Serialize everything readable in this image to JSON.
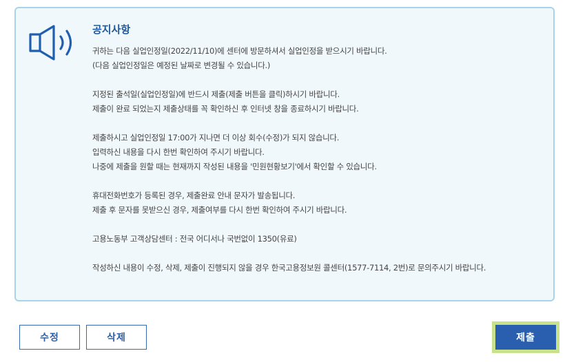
{
  "notice": {
    "icon": "speaker-icon",
    "title": "공지사항",
    "paragraphs": [
      [
        "귀하는 다음 실업인정일(2022/11/10)에 센터에 방문하셔서 실업인정을 받으시기 바랍니다.",
        "(다음 실업인정일은 예정된 날짜로 변경될 수 있습니다.)"
      ],
      [
        "지정된 출석일(실업인정일)에 반드시 제출(제출 버튼을 클릭)하시기 바랍니다.",
        "제출이 완료 되었는지 제출상태를 꼭 확인하신 후 인터넷 창을 종료하시기 바랍니다."
      ],
      [
        "제출하시고 실업인정일 17:00가 지나면 더 이상 회수(수정)가 되지 않습니다.",
        "입력하신 내용을 다시 한번 확인하여 주시기 바랍니다.",
        "나중에 제출을 원할 때는 현재까지 작성된 내용을 '민원현황보기'에서 확인할 수 있습니다."
      ],
      [
        "휴대전화번호가 등록된 경우, 제출완료 안내 문자가 발송됩니다.",
        "제출 후 문자를 못받으신 경우, 제출여부를 다시 한번 확인하여 주시기 바랍니다."
      ],
      [
        "고용노동부 고객상담센터 : 전국 어디서나 국번없이 1350(유료)"
      ],
      [
        "작성하신 내용이 수정, 삭제, 제출이 진행되지 않을 경우 한국고용정보원 콜센터(1577-7114, 2번)로 문의주시기 바랍니다."
      ]
    ]
  },
  "actions": {
    "edit_label": "수정",
    "delete_label": "삭제",
    "submit_label": "제출"
  },
  "colors": {
    "accent": "#2a5fb0",
    "panel_border": "#a7d4e8",
    "panel_bg": "#f1f8fb",
    "highlight": "#c7e28a"
  }
}
